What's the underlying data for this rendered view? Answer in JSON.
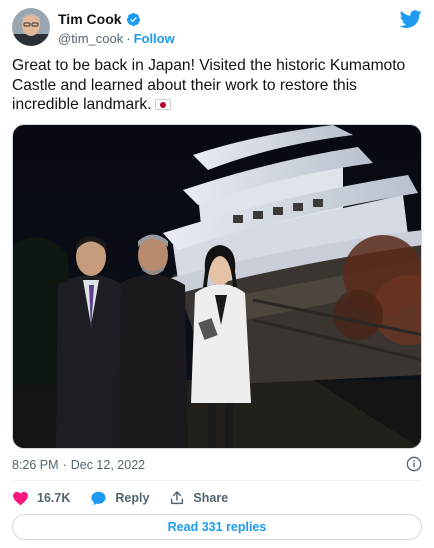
{
  "author": {
    "display_name": "Tim Cook",
    "handle": "@tim_cook",
    "separator": "·",
    "follow_label": "Follow",
    "verified": true
  },
  "tweet": {
    "text": "Great to be back in Japan! Visited the historic Kumamoto Castle and learned about their work to restore this incredible landmark.",
    "flag_emoji": "japan-flag"
  },
  "meta": {
    "time": "8:26 PM",
    "separator": "·",
    "date": "Dec 12, 2022"
  },
  "actions": {
    "likes": "16.7K",
    "reply_label": "Reply",
    "share_label": "Share"
  },
  "replies_button": "Read 331 replies",
  "colors": {
    "twitter_blue": "#1d9bf0",
    "like_pink": "#f91880",
    "secondary_text": "#536471"
  },
  "icons": [
    "verified-badge-icon",
    "twitter-bird-icon",
    "info-icon",
    "heart-icon",
    "reply-bubble-icon",
    "share-icon"
  ]
}
